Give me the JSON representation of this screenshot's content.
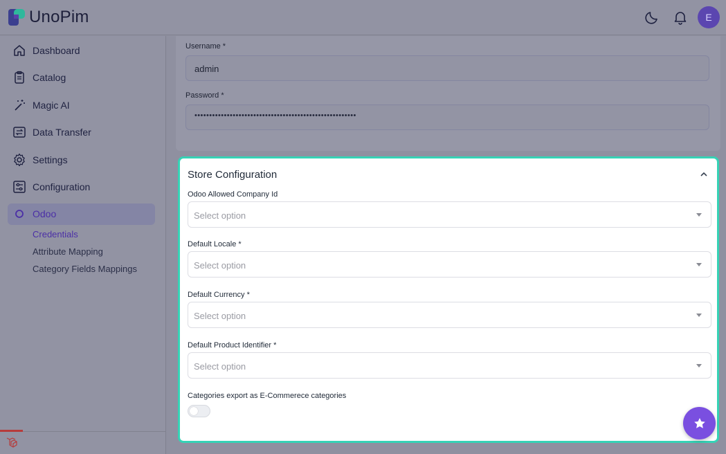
{
  "app": {
    "name": "UnoPim",
    "avatar_letter": "E"
  },
  "header": {
    "theme_icon": "moon-icon",
    "notification_icon": "bell-icon"
  },
  "sidebar": {
    "items": [
      {
        "label": "Dashboard",
        "icon": "home-icon"
      },
      {
        "label": "Catalog",
        "icon": "clipboard-icon"
      },
      {
        "label": "Magic AI",
        "icon": "magic-wand-icon"
      },
      {
        "label": "Data Transfer",
        "icon": "transfer-icon"
      },
      {
        "label": "Settings",
        "icon": "gear-icon"
      },
      {
        "label": "Configuration",
        "icon": "sliders-icon"
      },
      {
        "label": "Odoo",
        "icon": "circle-icon"
      }
    ],
    "sub_items": [
      {
        "label": "Credentials"
      },
      {
        "label": "Attribute Mapping"
      },
      {
        "label": "Category Fields Mappings"
      }
    ]
  },
  "credentials": {
    "username_label": "Username *",
    "username_value": "admin",
    "password_label": "Password *",
    "password_value": "•••••••••••••••••••••••••••••••••••••••••••••••••••••••"
  },
  "store_config": {
    "title": "Store Configuration",
    "fields": [
      {
        "label": "Odoo Allowed Company Id",
        "placeholder": "Select option"
      },
      {
        "label": "Default Locale *",
        "placeholder": "Select option"
      },
      {
        "label": "Default Currency *",
        "placeholder": "Select option"
      },
      {
        "label": "Default Product Identifier *",
        "placeholder": "Select option"
      }
    ],
    "toggle_label": "Categories export as E-Commerece categories",
    "toggle_on": false
  },
  "colors": {
    "accent": "#7a4fe0",
    "highlight_border": "#35d3b6",
    "active_text": "#4b2fa6"
  }
}
